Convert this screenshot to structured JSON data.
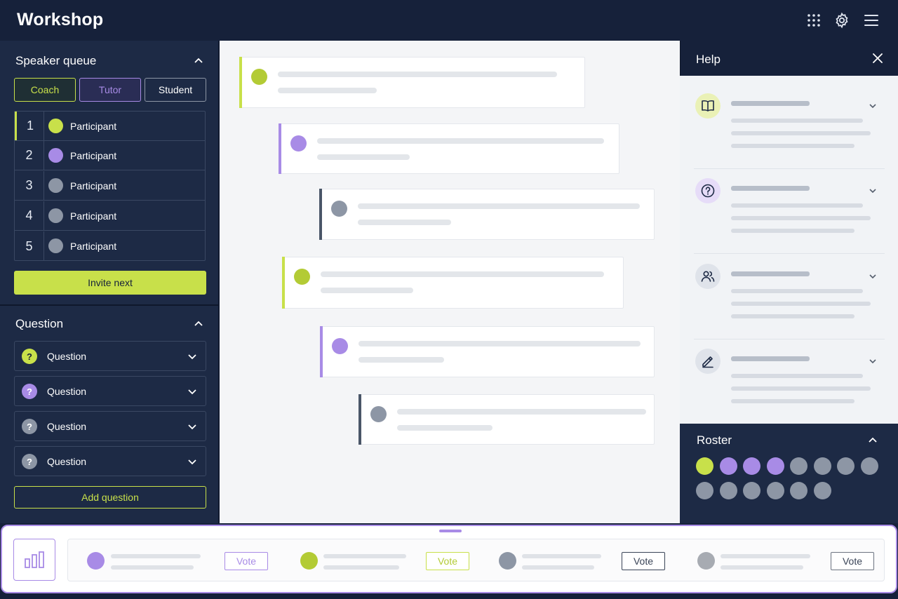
{
  "app": {
    "title": "Workshop"
  },
  "toolbar": {
    "apps_icon": "grid-icon",
    "settings_icon": "gear-icon",
    "menu_icon": "hamburger-menu-icon"
  },
  "speaker_queue": {
    "title": "Speaker queue",
    "roles": [
      {
        "label": "Coach",
        "state": "selected-lime"
      },
      {
        "label": "Tutor",
        "state": "selected-purple"
      },
      {
        "label": "Student",
        "state": "default"
      }
    ],
    "participants": [
      {
        "number": "1",
        "label": "Participant",
        "color": "#c8e04a"
      },
      {
        "number": "2",
        "label": "Participant",
        "color": "#a88be6"
      },
      {
        "number": "3",
        "label": "Participant",
        "color": "#8d96a5"
      },
      {
        "number": "4",
        "label": "Participant",
        "color": "#8d96a5"
      },
      {
        "number": "5",
        "label": "Participant",
        "color": "#8d96a5"
      }
    ],
    "invite_label": "Invite next"
  },
  "questions": {
    "title": "Question",
    "items": [
      {
        "label": "Question",
        "icon_text": "?",
        "color": "#c8e04a"
      },
      {
        "label": "Question",
        "icon_text": "?",
        "color": "#a88be6"
      },
      {
        "label": "Question",
        "icon_text": "?",
        "color": "#8d96a5"
      },
      {
        "label": "Question",
        "icon_text": "?",
        "color": "#8d96a5"
      }
    ],
    "add_label": "Add question"
  },
  "help": {
    "title": "Help",
    "close_icon": "close-icon",
    "items": [
      {
        "icon": "book-icon"
      },
      {
        "icon": "question-circle-icon"
      },
      {
        "icon": "users-icon"
      },
      {
        "icon": "edit-pen-icon"
      }
    ]
  },
  "roster": {
    "title": "Roster",
    "members": [
      "#c8e04a",
      "#a88be6",
      "#a88be6",
      "#a88be6",
      "#8d96a5",
      "#8d96a5",
      "#8d96a5",
      "#8d96a5",
      "#8d96a5",
      "#8d96a5",
      "#8d96a5",
      "#8d96a5",
      "#8d96a5",
      "#8d96a5"
    ]
  },
  "polls": {
    "chart_icon": "bar-chart-icon",
    "vote_label": "Vote",
    "items": [
      {
        "color": "#a88be6",
        "vote_label": "Vote"
      },
      {
        "color": "#c8e04a",
        "vote_label": "Vote"
      },
      {
        "color": "#8d96a5",
        "vote_label": "Vote"
      },
      {
        "color": "#a7abb2",
        "vote_label": "Vote"
      }
    ]
  },
  "colors": {
    "lime": "#c8e04a",
    "purple": "#a88be6",
    "gray": "#8d96a5",
    "navy": "#16213a",
    "panel": "#1d2a45"
  }
}
